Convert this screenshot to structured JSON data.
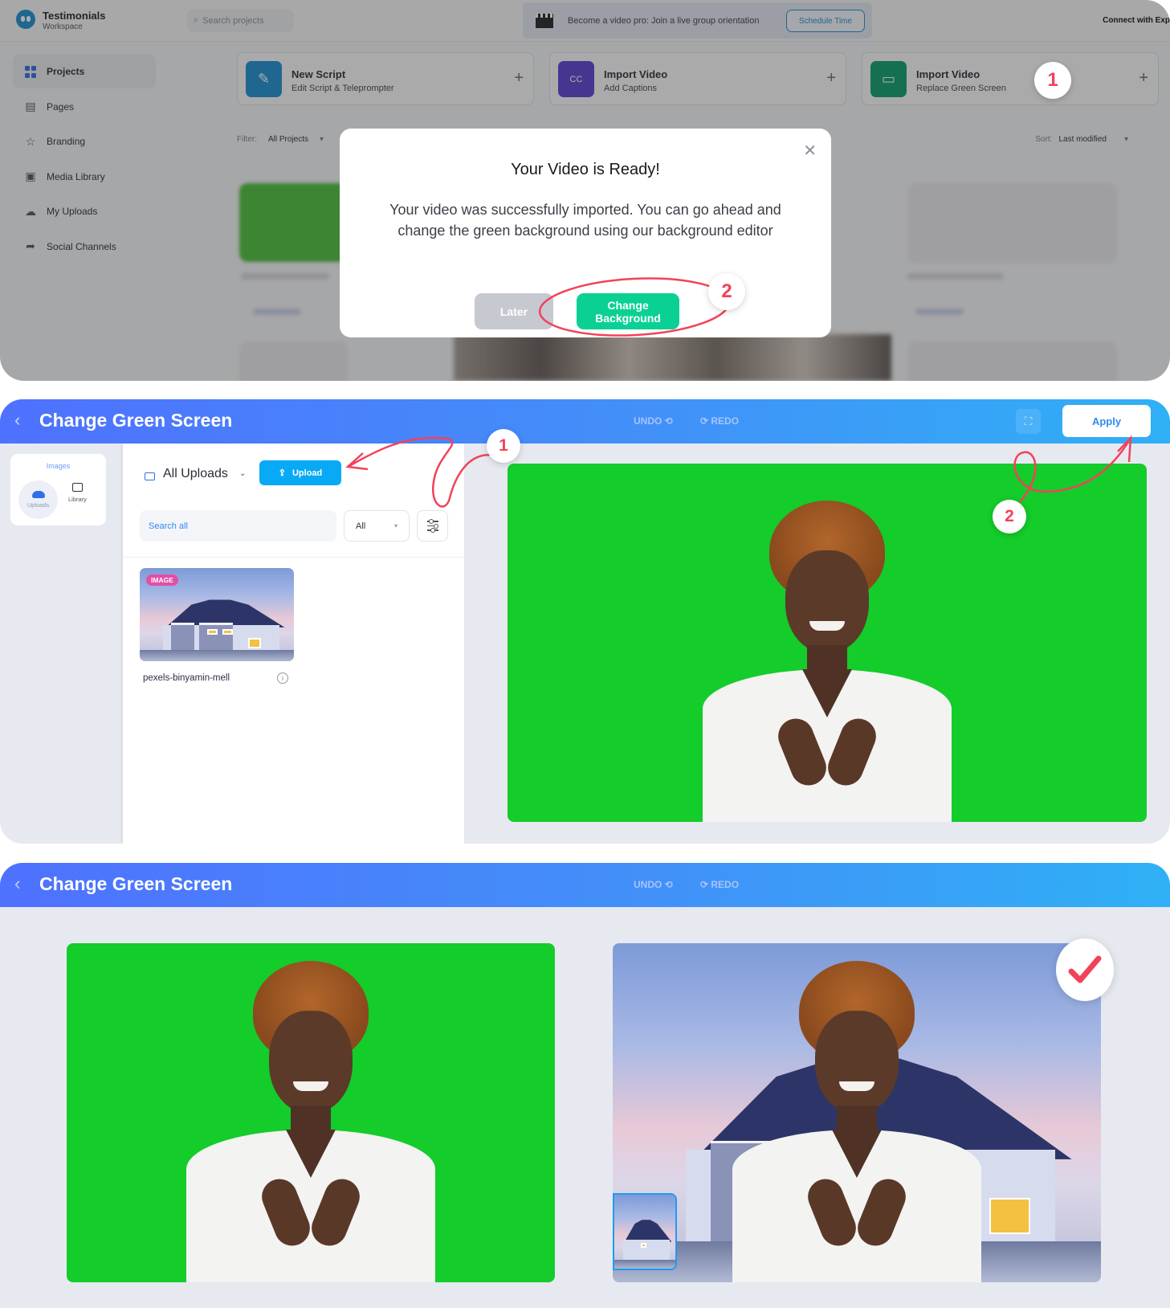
{
  "panel1": {
    "brand": {
      "name": "Testimonials",
      "sub": "Workspace"
    },
    "search": {
      "placeholder": "Search projects"
    },
    "banner": {
      "text": "Become a video pro: Join a live group orientation",
      "button": "Schedule Time"
    },
    "connect_text": "Connect with Exp",
    "sidebar": {
      "items": [
        {
          "label": "Projects",
          "icon": "grid-icon",
          "active": true
        },
        {
          "label": "Pages",
          "icon": "pages-icon"
        },
        {
          "label": "Branding",
          "icon": "star-icon"
        },
        {
          "label": "Media Library",
          "icon": "media-folder-icon"
        },
        {
          "label": "My Uploads",
          "icon": "cloud-upload-icon"
        },
        {
          "label": "Social Channels",
          "icon": "share-icon"
        }
      ]
    },
    "action_cards": [
      {
        "title": "New Script",
        "subtitle": "Edit Script & Teleprompter",
        "icon": "pencil-icon",
        "color": "#1a8fd0"
      },
      {
        "title": "Import Video",
        "subtitle": "Add Captions",
        "icon": "captions-icon",
        "color": "#5b3fd0"
      },
      {
        "title": "Import Video",
        "subtitle": "Replace Green Screen",
        "icon": "clapper-icon",
        "color": "#0b9d6c"
      }
    ],
    "filter": {
      "label": "Filter:",
      "value": "All Projects"
    },
    "sort": {
      "label": "Sort:",
      "value": "Last modified"
    },
    "modal": {
      "title": "Your Video is Ready!",
      "body": "Your video was successfully imported. You can go ahead and change the green background using our background editor",
      "later_label": "Later",
      "change_label": "Change Background"
    },
    "step_badges": [
      "1",
      "2"
    ]
  },
  "editor": {
    "title": "Change Green Screen",
    "undo": "UNDO ⟲",
    "redo": "⟳ REDO",
    "apply": "Apply",
    "rail": {
      "label": "Images",
      "uploads": "Uploads",
      "library": "Library"
    },
    "uploads_panel": {
      "folder": "All Uploads",
      "upload_button": "Upload",
      "search_placeholder": "Search all",
      "type_select": "All",
      "item": {
        "badge": "IMAGE",
        "name": "pexels-binyamin-mell"
      }
    },
    "step_badges": [
      "1",
      "2"
    ]
  },
  "colors": {
    "accent_blue": "#2d8cf0",
    "green_screen": "#14cc2a",
    "cta_green": "#0ad193",
    "annotation_red": "#f2425a"
  }
}
